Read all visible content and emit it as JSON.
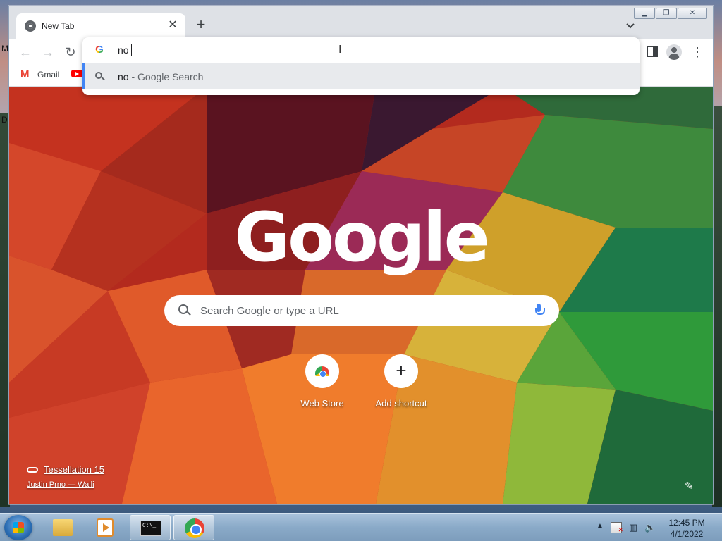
{
  "desktop": {
    "letter_m": "M",
    "letter_d": "D"
  },
  "browser": {
    "tab": {
      "title": "New Tab",
      "close_label": "✕"
    },
    "new_tab_label": "+",
    "window_controls": {
      "minimize": "▁",
      "restore": "❐",
      "close": "✕"
    },
    "toolbar": {
      "back": "←",
      "forward": "→",
      "reload": "↻",
      "menu": "⋮"
    },
    "bookmarks": [
      {
        "label": "Gmail",
        "icon": "gmail-icon"
      },
      {
        "label": "",
        "icon": "youtube-icon"
      }
    ],
    "omnibox": {
      "typed_text": "no",
      "suggestion": {
        "query": "no",
        "separator": " - ",
        "provider": "Google Search"
      }
    }
  },
  "newtab": {
    "logo_text": "Google",
    "search_placeholder": "Search Google or type a URL",
    "shortcuts": [
      {
        "label": "Web Store",
        "icon": "webstore-icon"
      },
      {
        "label": "Add shortcut",
        "icon": "plus-icon"
      }
    ],
    "attribution": {
      "title": "Tessellation 15",
      "artist": "Justin Prno — Walli"
    }
  },
  "taskbar": {
    "clock": {
      "time": "12:45 PM",
      "date": "4/1/2022"
    },
    "tray_arrow": "▲",
    "cmd_text": "C:\\_"
  }
}
